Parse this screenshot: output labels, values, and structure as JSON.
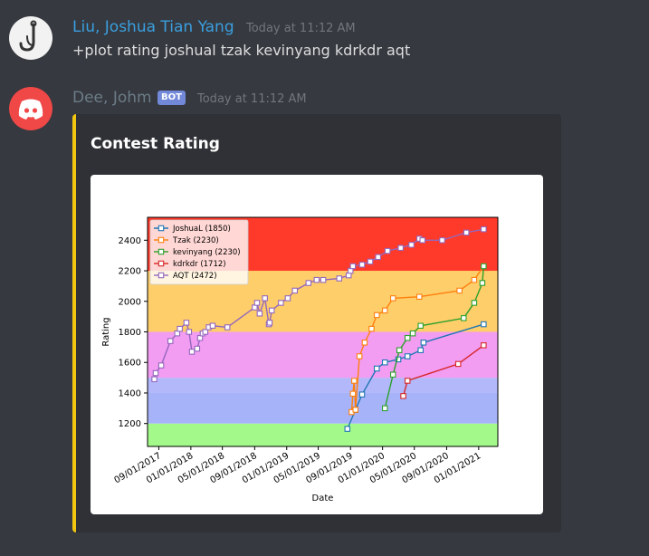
{
  "messages": [
    {
      "author": "Liu, Joshua Tian Yang",
      "author_color": "#3a9fe0",
      "timestamp": "Today at 11:12 AM",
      "text": "+plot rating joshual tzak kevinyang kdrkdr aqt"
    },
    {
      "author": "Dee, Johm",
      "author_color": "#6b7c87",
      "bot_tag": "BOT",
      "timestamp": "Today at 11:12 AM",
      "embed": {
        "title": "Contest Rating",
        "accent": "#f1c40f"
      }
    }
  ],
  "chart_data": {
    "type": "line",
    "xlabel": "Date",
    "ylabel": "Rating",
    "ylim": [
      1050,
      2550
    ],
    "xlim": [
      "2017-07-20",
      "2021-03-15"
    ],
    "yticks": [
      1200,
      1400,
      1600,
      1800,
      2000,
      2200,
      2400
    ],
    "xticks": [
      "09/01/2017",
      "01/01/2018",
      "05/01/2018",
      "09/01/2018",
      "01/01/2019",
      "05/01/2019",
      "09/01/2019",
      "01/01/2020",
      "05/01/2020",
      "09/01/2020",
      "01/01/2021"
    ],
    "bands": [
      {
        "from": 1050,
        "to": 1200,
        "color": "#a3f98a"
      },
      {
        "from": 1200,
        "to": 1400,
        "color": "#a7b3f9"
      },
      {
        "from": 1400,
        "to": 1500,
        "color": "#b3b8fb"
      },
      {
        "from": 1500,
        "to": 1800,
        "color": "#f29cf2"
      },
      {
        "from": 1800,
        "to": 2200,
        "color": "#fece6a"
      },
      {
        "from": 2200,
        "to": 2550,
        "color": "#ff3a2a"
      }
    ],
    "legend_position": "top-left",
    "series": [
      {
        "name": "JoshuaL (1850)",
        "color": "#1f77b4",
        "x": [
          "2019-08-20",
          "2019-09-20",
          "2019-10-15",
          "2019-12-10",
          "2020-01-10",
          "2020-03-01",
          "2020-04-05",
          "2020-05-25",
          "2020-06-05",
          "2021-01-20"
        ],
        "values": [
          1165,
          1290,
          1390,
          1560,
          1600,
          1620,
          1640,
          1680,
          1730,
          1850
        ]
      },
      {
        "name": "Tzak (2230)",
        "color": "#ff7f0e",
        "x": [
          "2019-09-05",
          "2019-09-10",
          "2019-09-15",
          "2019-09-20",
          "2019-10-05",
          "2019-10-25",
          "2019-11-20",
          "2019-12-10",
          "2020-01-10",
          "2020-02-10",
          "2020-05-20",
          "2020-10-20",
          "2020-12-15",
          "2021-01-20"
        ],
        "values": [
          1275,
          1395,
          1480,
          1290,
          1640,
          1730,
          1820,
          1910,
          1940,
          2020,
          2030,
          2070,
          2140,
          2230
        ]
      },
      {
        "name": "kevinyang (2230)",
        "color": "#2ca02c",
        "x": [
          "2020-01-10",
          "2020-02-10",
          "2020-03-05",
          "2020-04-05",
          "2020-04-25",
          "2020-05-25",
          "2020-11-05",
          "2020-12-15",
          "2021-01-15",
          "2021-01-20"
        ],
        "values": [
          1300,
          1520,
          1680,
          1760,
          1790,
          1840,
          1890,
          1990,
          2120,
          2230
        ]
      },
      {
        "name": "kdrkdr (1712)",
        "color": "#d62728",
        "x": [
          "2020-03-20",
          "2020-04-05",
          "2020-10-15",
          "2021-01-20"
        ],
        "values": [
          1380,
          1480,
          1590,
          1712
        ]
      },
      {
        "name": "AQT (2472)",
        "color": "#9467bd",
        "x": [
          "2017-08-15",
          "2017-08-20",
          "2017-09-10",
          "2017-10-15",
          "2017-11-10",
          "2017-11-20",
          "2017-12-15",
          "2017-12-25",
          "2018-01-05",
          "2018-01-25",
          "2018-02-05",
          "2018-02-15",
          "2018-02-25",
          "2018-03-10",
          "2018-03-25",
          "2018-05-20",
          "2018-09-01",
          "2018-09-10",
          "2018-09-20",
          "2018-10-10",
          "2018-10-25",
          "2018-10-28",
          "2018-11-05",
          "2018-12-10",
          "2019-01-05",
          "2019-02-01",
          "2019-03-25",
          "2019-04-25",
          "2019-05-20",
          "2019-07-20",
          "2019-08-25",
          "2019-09-01",
          "2019-09-10",
          "2019-10-15",
          "2019-11-15",
          "2019-12-15",
          "2020-01-20",
          "2020-03-10",
          "2020-04-20",
          "2020-05-20",
          "2020-06-01",
          "2020-08-15",
          "2020-11-15",
          "2021-01-20"
        ],
        "values": [
          1490,
          1530,
          1580,
          1740,
          1790,
          1820,
          1860,
          1800,
          1670,
          1690,
          1760,
          1790,
          1800,
          1830,
          1840,
          1830,
          1960,
          1990,
          1920,
          2020,
          1850,
          1860,
          1940,
          1990,
          2020,
          2070,
          2120,
          2140,
          2140,
          2150,
          2170,
          2200,
          2230,
          2240,
          2260,
          2290,
          2330,
          2350,
          2370,
          2410,
          2400,
          2400,
          2450,
          2472
        ]
      }
    ]
  }
}
